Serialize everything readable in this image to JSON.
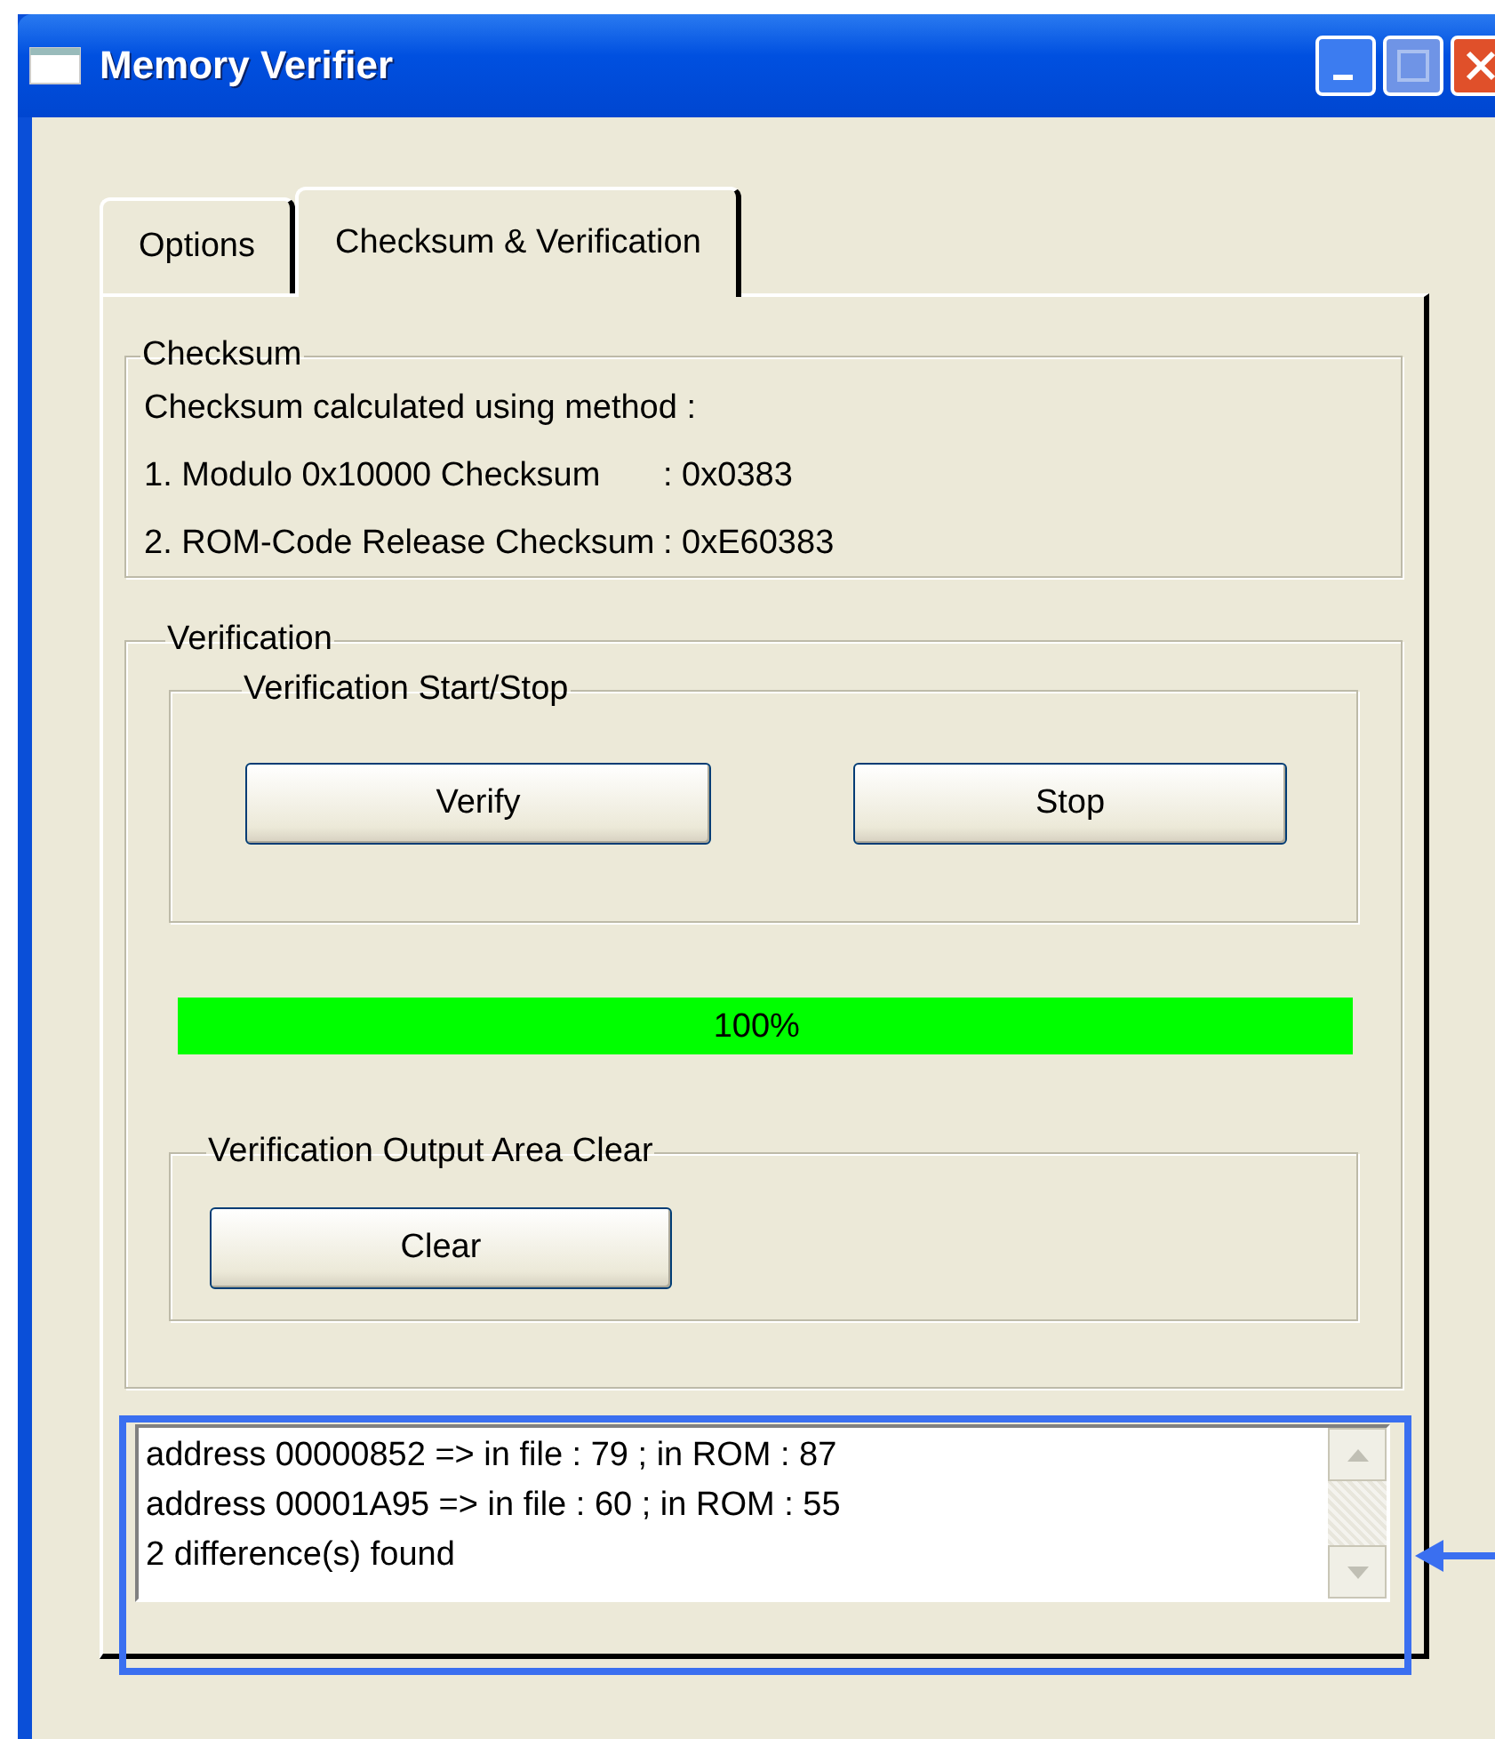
{
  "window": {
    "title": "Memory Verifier"
  },
  "tabs": [
    {
      "label": "Options",
      "selected": false
    },
    {
      "label": "Checksum & Verification",
      "selected": true
    }
  ],
  "checksum": {
    "title": "Checksum",
    "lines": [
      "Checksum calculated using method :",
      "1. Modulo 0x10000 Checksum",
      "2. ROM-Code Release Checksum"
    ],
    "values": [
      ":  0x0383",
      ":  0xE60383"
    ]
  },
  "verification": {
    "title": "Verification",
    "start_stop": {
      "title": "Verification Start/Stop",
      "buttons": [
        "Verify",
        "Stop"
      ]
    },
    "progress": {
      "level": 1,
      "reading": "100%"
    },
    "clear_group": {
      "title": "Verification Output Area Clear",
      "button": "Clear"
    }
  },
  "output": {
    "lines": [
      "address 00000852 => in file : 79 ; in ROM : 87",
      "address 00001A95 => in file : 60 ; in ROM : 55",
      "2 difference(s) found"
    ]
  }
}
